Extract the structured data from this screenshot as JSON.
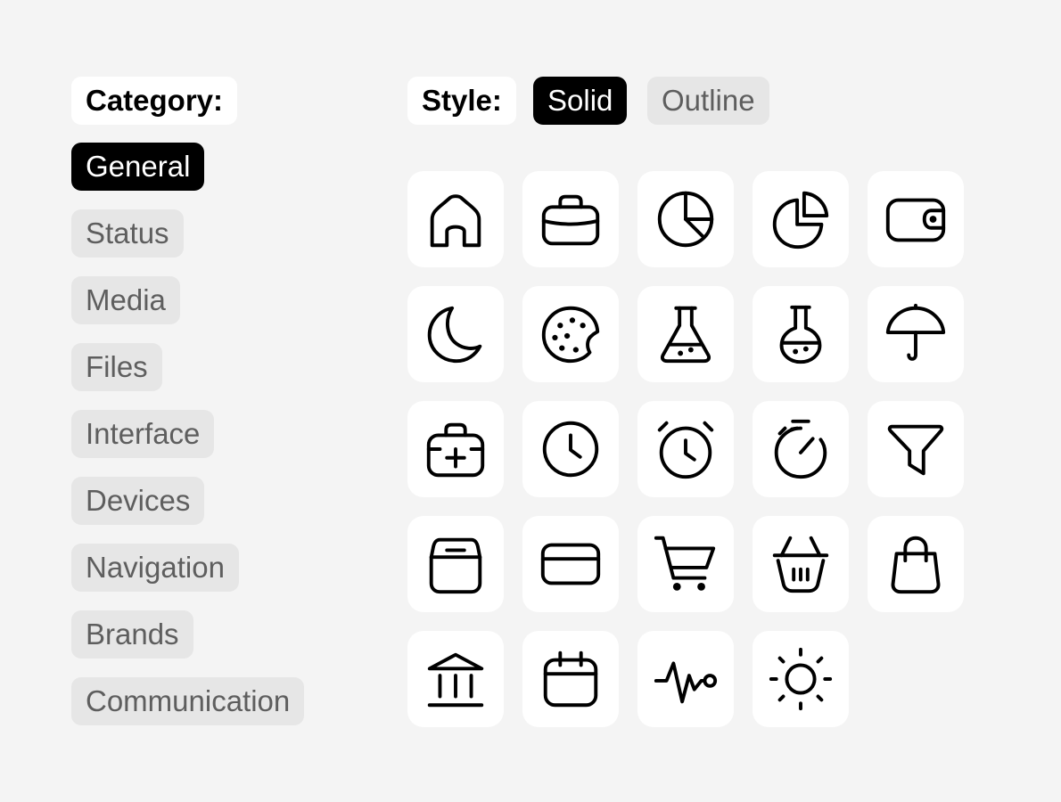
{
  "category": {
    "label": "Category:",
    "items": [
      "General",
      "Status",
      "Media",
      "Files",
      "Interface",
      "Devices",
      "Navigation",
      "Brands",
      "Communication"
    ],
    "selected": "General"
  },
  "style": {
    "label": "Style:",
    "options": [
      "Solid",
      "Outline"
    ],
    "selected": "Solid"
  },
  "icons": [
    "home-icon",
    "briefcase-icon",
    "pie-chart-icon",
    "pie-chart-split-icon",
    "wallet-icon",
    "moon-icon",
    "cookie-icon",
    "flask-icon",
    "round-flask-icon",
    "umbrella-icon",
    "first-aid-kit-icon",
    "clock-icon",
    "alarm-clock-icon",
    "stopwatch-icon",
    "filter-icon",
    "archive-icon",
    "credit-card-icon",
    "shopping-cart-icon",
    "basket-icon",
    "shopping-bag-icon",
    "bank-icon",
    "calendar-icon",
    "pulse-icon",
    "sun-icon"
  ],
  "colors": {
    "background": "#f4f4f4",
    "active": "#000000",
    "inactive": "#e6e6e6",
    "inactive_text": "#5e5e5e",
    "tile": "#ffffff"
  }
}
